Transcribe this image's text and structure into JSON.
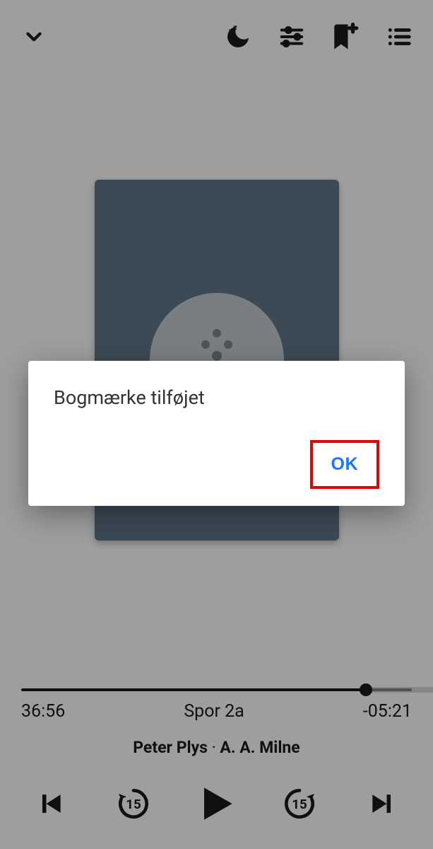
{
  "toolbar": {
    "collapse_name": "collapse",
    "sleep_name": "sleep-timer",
    "settings_name": "playback-settings",
    "bookmark_name": "add-bookmark",
    "chapters_name": "chapters"
  },
  "progress": {
    "elapsed": "36:56",
    "track_label": "Spor 2a",
    "remaining": "-05:21"
  },
  "book": {
    "title": "Peter Plys",
    "separator": " · ",
    "author": "A. A. Milne"
  },
  "controls": {
    "rewind_seconds": "15",
    "forward_seconds": "15"
  },
  "dialog": {
    "message": "Bogmærke tilføjet",
    "ok_label": "OK"
  }
}
